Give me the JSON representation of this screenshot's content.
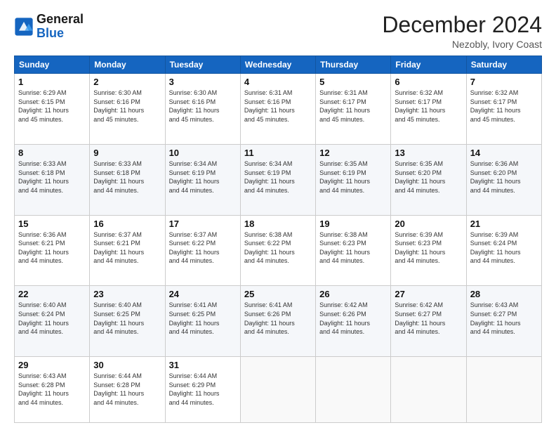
{
  "header": {
    "logo_line1": "General",
    "logo_line2": "Blue",
    "month_title": "December 2024",
    "location": "Nezobly, Ivory Coast"
  },
  "days_of_week": [
    "Sunday",
    "Monday",
    "Tuesday",
    "Wednesday",
    "Thursday",
    "Friday",
    "Saturday"
  ],
  "weeks": [
    [
      {
        "day": "1",
        "info": "Sunrise: 6:29 AM\nSunset: 6:15 PM\nDaylight: 11 hours\nand 45 minutes."
      },
      {
        "day": "2",
        "info": "Sunrise: 6:30 AM\nSunset: 6:16 PM\nDaylight: 11 hours\nand 45 minutes."
      },
      {
        "day": "3",
        "info": "Sunrise: 6:30 AM\nSunset: 6:16 PM\nDaylight: 11 hours\nand 45 minutes."
      },
      {
        "day": "4",
        "info": "Sunrise: 6:31 AM\nSunset: 6:16 PM\nDaylight: 11 hours\nand 45 minutes."
      },
      {
        "day": "5",
        "info": "Sunrise: 6:31 AM\nSunset: 6:17 PM\nDaylight: 11 hours\nand 45 minutes."
      },
      {
        "day": "6",
        "info": "Sunrise: 6:32 AM\nSunset: 6:17 PM\nDaylight: 11 hours\nand 45 minutes."
      },
      {
        "day": "7",
        "info": "Sunrise: 6:32 AM\nSunset: 6:17 PM\nDaylight: 11 hours\nand 45 minutes."
      }
    ],
    [
      {
        "day": "8",
        "info": "Sunrise: 6:33 AM\nSunset: 6:18 PM\nDaylight: 11 hours\nand 44 minutes."
      },
      {
        "day": "9",
        "info": "Sunrise: 6:33 AM\nSunset: 6:18 PM\nDaylight: 11 hours\nand 44 minutes."
      },
      {
        "day": "10",
        "info": "Sunrise: 6:34 AM\nSunset: 6:19 PM\nDaylight: 11 hours\nand 44 minutes."
      },
      {
        "day": "11",
        "info": "Sunrise: 6:34 AM\nSunset: 6:19 PM\nDaylight: 11 hours\nand 44 minutes."
      },
      {
        "day": "12",
        "info": "Sunrise: 6:35 AM\nSunset: 6:19 PM\nDaylight: 11 hours\nand 44 minutes."
      },
      {
        "day": "13",
        "info": "Sunrise: 6:35 AM\nSunset: 6:20 PM\nDaylight: 11 hours\nand 44 minutes."
      },
      {
        "day": "14",
        "info": "Sunrise: 6:36 AM\nSunset: 6:20 PM\nDaylight: 11 hours\nand 44 minutes."
      }
    ],
    [
      {
        "day": "15",
        "info": "Sunrise: 6:36 AM\nSunset: 6:21 PM\nDaylight: 11 hours\nand 44 minutes."
      },
      {
        "day": "16",
        "info": "Sunrise: 6:37 AM\nSunset: 6:21 PM\nDaylight: 11 hours\nand 44 minutes."
      },
      {
        "day": "17",
        "info": "Sunrise: 6:37 AM\nSunset: 6:22 PM\nDaylight: 11 hours\nand 44 minutes."
      },
      {
        "day": "18",
        "info": "Sunrise: 6:38 AM\nSunset: 6:22 PM\nDaylight: 11 hours\nand 44 minutes."
      },
      {
        "day": "19",
        "info": "Sunrise: 6:38 AM\nSunset: 6:23 PM\nDaylight: 11 hours\nand 44 minutes."
      },
      {
        "day": "20",
        "info": "Sunrise: 6:39 AM\nSunset: 6:23 PM\nDaylight: 11 hours\nand 44 minutes."
      },
      {
        "day": "21",
        "info": "Sunrise: 6:39 AM\nSunset: 6:24 PM\nDaylight: 11 hours\nand 44 minutes."
      }
    ],
    [
      {
        "day": "22",
        "info": "Sunrise: 6:40 AM\nSunset: 6:24 PM\nDaylight: 11 hours\nand 44 minutes."
      },
      {
        "day": "23",
        "info": "Sunrise: 6:40 AM\nSunset: 6:25 PM\nDaylight: 11 hours\nand 44 minutes."
      },
      {
        "day": "24",
        "info": "Sunrise: 6:41 AM\nSunset: 6:25 PM\nDaylight: 11 hours\nand 44 minutes."
      },
      {
        "day": "25",
        "info": "Sunrise: 6:41 AM\nSunset: 6:26 PM\nDaylight: 11 hours\nand 44 minutes."
      },
      {
        "day": "26",
        "info": "Sunrise: 6:42 AM\nSunset: 6:26 PM\nDaylight: 11 hours\nand 44 minutes."
      },
      {
        "day": "27",
        "info": "Sunrise: 6:42 AM\nSunset: 6:27 PM\nDaylight: 11 hours\nand 44 minutes."
      },
      {
        "day": "28",
        "info": "Sunrise: 6:43 AM\nSunset: 6:27 PM\nDaylight: 11 hours\nand 44 minutes."
      }
    ],
    [
      {
        "day": "29",
        "info": "Sunrise: 6:43 AM\nSunset: 6:28 PM\nDaylight: 11 hours\nand 44 minutes."
      },
      {
        "day": "30",
        "info": "Sunrise: 6:44 AM\nSunset: 6:28 PM\nDaylight: 11 hours\nand 44 minutes."
      },
      {
        "day": "31",
        "info": "Sunrise: 6:44 AM\nSunset: 6:29 PM\nDaylight: 11 hours\nand 44 minutes."
      },
      {
        "day": "",
        "info": ""
      },
      {
        "day": "",
        "info": ""
      },
      {
        "day": "",
        "info": ""
      },
      {
        "day": "",
        "info": ""
      }
    ]
  ]
}
